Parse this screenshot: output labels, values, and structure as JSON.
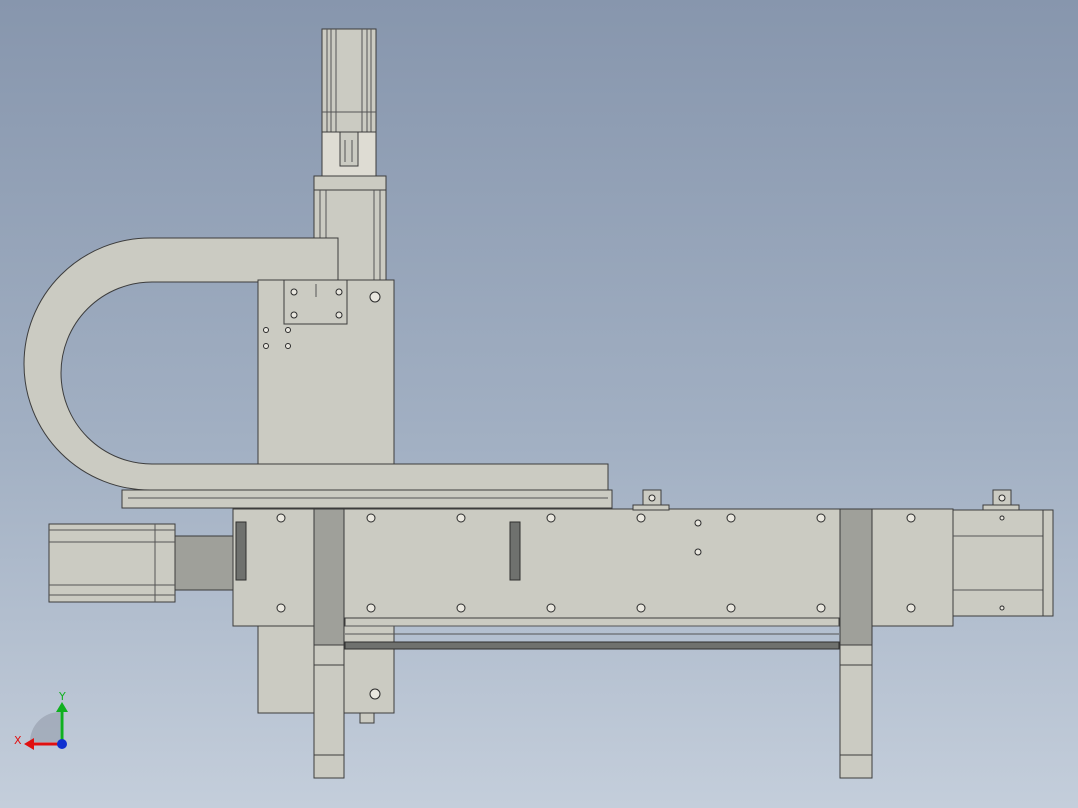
{
  "triad": {
    "x_label": "X",
    "y_label": "Y",
    "x_color": "#e01010",
    "y_color": "#10b020",
    "z_color": "#1030d0"
  },
  "colors": {
    "background_top": "#8796ad",
    "background_bottom": "#c4cedb",
    "part_body": "#cbcbc2",
    "part_dark": "#6f716e",
    "edge": "#3c3c3c"
  }
}
